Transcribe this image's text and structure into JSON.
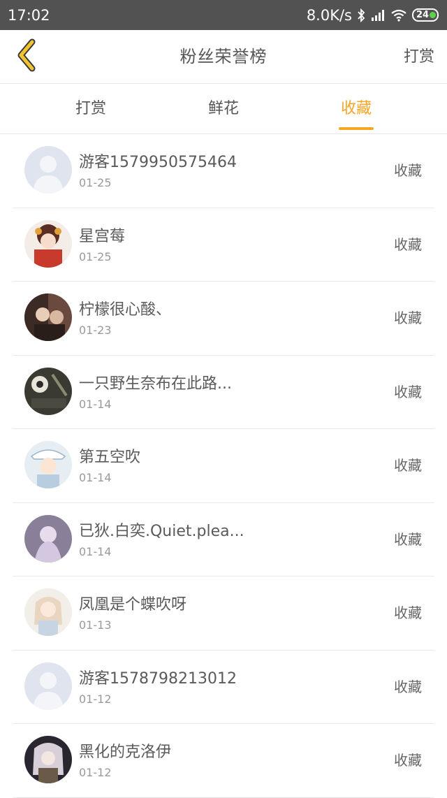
{
  "status_bar": {
    "time": "17:02",
    "network_speed": "8.0K/s",
    "battery": "24",
    "icons": [
      "bluetooth-icon",
      "signal-icon",
      "wifi-icon",
      "battery-icon"
    ]
  },
  "header": {
    "back_icon": "chevron-left-icon",
    "title": "粉丝荣誉榜",
    "action": "打赏"
  },
  "tabs": [
    {
      "label": "打赏",
      "active": false
    },
    {
      "label": "鲜花",
      "active": false
    },
    {
      "label": "收藏",
      "active": true
    }
  ],
  "colors": {
    "accent": "#f5a623",
    "status_bar": "#525252",
    "text": "#5a5a5a",
    "subtext": "#9a9a9a",
    "divider": "#e8e8e8"
  },
  "list": [
    {
      "name": "游客1579950575464",
      "date": "01-25",
      "action": "收藏",
      "avatar": "default-avatar"
    },
    {
      "name": "星宫莓",
      "date": "01-25",
      "action": "收藏",
      "avatar": "user-avatar"
    },
    {
      "name": "柠檬很心酸、",
      "date": "01-23",
      "action": "收藏",
      "avatar": "user-avatar"
    },
    {
      "name": "一只野生奈布在此路...",
      "date": "01-14",
      "action": "收藏",
      "avatar": "user-avatar"
    },
    {
      "name": "第五空吹",
      "date": "01-14",
      "action": "收藏",
      "avatar": "user-avatar"
    },
    {
      "name": "已狄.白奕.Quiet.plea...",
      "date": "01-14",
      "action": "收藏",
      "avatar": "user-avatar"
    },
    {
      "name": "凤凰是个蝶吹呀",
      "date": "01-13",
      "action": "收藏",
      "avatar": "user-avatar"
    },
    {
      "name": "游客1578798213012",
      "date": "01-12",
      "action": "收藏",
      "avatar": "default-avatar"
    },
    {
      "name": "黑化的克洛伊",
      "date": "01-12",
      "action": "收藏",
      "avatar": "user-avatar"
    }
  ]
}
